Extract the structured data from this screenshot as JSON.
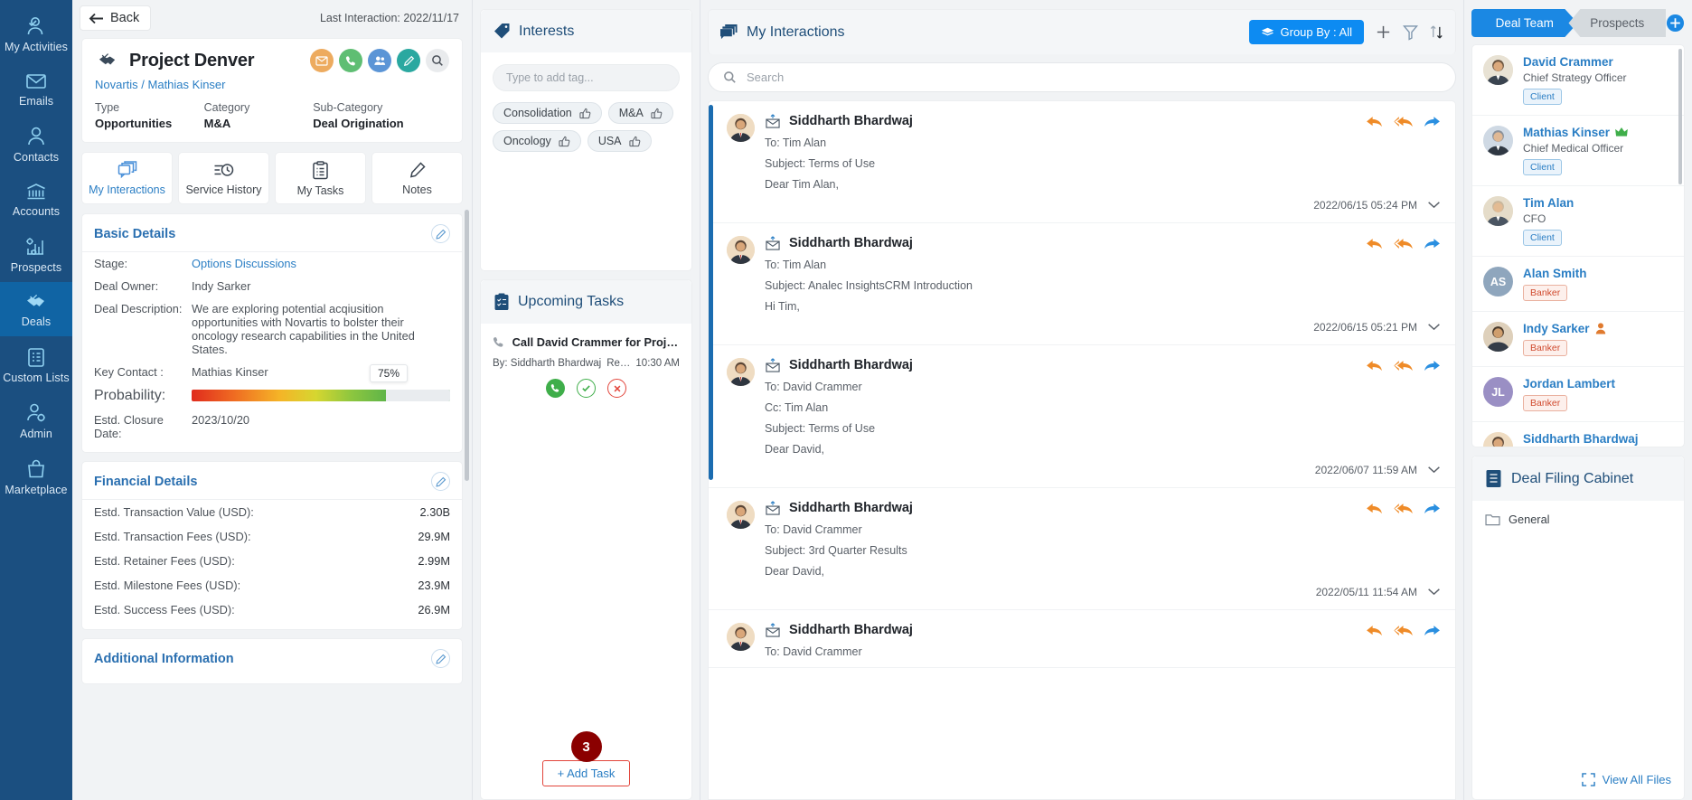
{
  "leftnav": {
    "items": [
      {
        "label": "My Activities",
        "icon": "user-check-icon",
        "active": false
      },
      {
        "label": "Emails",
        "icon": "envelope-icon",
        "active": false
      },
      {
        "label": "Contacts",
        "icon": "user-icon",
        "active": false
      },
      {
        "label": "Accounts",
        "icon": "bank-icon",
        "active": false
      },
      {
        "label": "Prospects",
        "icon": "chart-gear-icon",
        "active": false
      },
      {
        "label": "Deals",
        "icon": "handshake-check-icon",
        "active": true
      },
      {
        "label": "Custom Lists",
        "icon": "clipboard-list-icon",
        "active": false
      },
      {
        "label": "Admin",
        "icon": "user-gear-icon",
        "active": false
      },
      {
        "label": "Marketplace",
        "icon": "shopping-bag-icon",
        "active": false
      }
    ]
  },
  "detail": {
    "back_label": "Back",
    "last_interaction": "Last Interaction: 2022/11/17",
    "deal_title": "Project Denver",
    "deal_subtitle": "Novartis / Mathias Kinser",
    "actions": [
      {
        "name": "email-action",
        "icon": "envelope-icon"
      },
      {
        "name": "call-action",
        "icon": "phone-icon"
      },
      {
        "name": "meeting-action",
        "icon": "users-icon"
      },
      {
        "name": "note-action",
        "icon": "pencil-icon"
      },
      {
        "name": "search-action",
        "icon": "search-icon"
      }
    ],
    "meta": [
      {
        "key": "Type",
        "value": "Opportunities"
      },
      {
        "key": "Category",
        "value": "M&A"
      },
      {
        "key": "Sub-Category",
        "value": "Deal Origination"
      }
    ],
    "tabs": [
      {
        "label": "My Interactions",
        "icon": "chat-stack-icon",
        "active": true
      },
      {
        "label": "Service History",
        "icon": "history-icon",
        "active": false
      },
      {
        "label": "My Tasks",
        "icon": "clipboard-icon",
        "active": false
      },
      {
        "label": "Notes",
        "icon": "note-pencil-icon",
        "active": false
      }
    ],
    "basic": {
      "title": "Basic Details",
      "rows": [
        {
          "key": "Stage:",
          "value": "Options Discussions",
          "link": true
        },
        {
          "key": "Deal Owner:",
          "value": "Indy Sarker",
          "link": false
        },
        {
          "key": "Deal Description:",
          "value": "We are exploring potential acqiusition opportunities with Novartis to bolster their oncology research capabilities in the United States.",
          "link": false
        },
        {
          "key": "Key Contact :",
          "value": "Mathias Kinser",
          "link": false
        }
      ],
      "probability_label": "Probability:",
      "probability_value": "75%",
      "probability_pct": 75,
      "closure_key": "Estd. Closure Date:",
      "closure_value": "2023/10/20"
    },
    "financial": {
      "title": "Financial Details",
      "rows": [
        {
          "key": "Estd. Transaction Value (USD):",
          "value": "2.30B"
        },
        {
          "key": "Estd. Transaction Fees (USD):",
          "value": "29.9M"
        },
        {
          "key": "Estd. Retainer Fees (USD):",
          "value": "2.99M"
        },
        {
          "key": "Estd. Milestone Fees (USD):",
          "value": "23.9M"
        },
        {
          "key": "Estd. Success Fees (USD):",
          "value": "26.9M"
        }
      ]
    },
    "additional": {
      "title": "Additional Information"
    }
  },
  "interests": {
    "title": "Interests",
    "icon": "tag-icon",
    "input_placeholder": "Type to add tag...",
    "tags": [
      "Consolidation",
      "M&A",
      "Oncology",
      "USA"
    ]
  },
  "tasks": {
    "title": "Upcoming Tasks",
    "icon": "clipboard-check-icon",
    "item": {
      "title": "Call David Crammer for Project ...",
      "by": "By: Siddharth Bhardwaj",
      "recipient": "Recipien...",
      "time": "10:30 AM"
    },
    "badge": "3",
    "add_label": "+ Add Task"
  },
  "interactions": {
    "title": "My Interactions",
    "icon": "chat-stack-icon",
    "group_by_label": "Group By : All",
    "search_placeholder": "Search",
    "tools": [
      "add-icon",
      "filter-icon",
      "sort-icon"
    ],
    "items": [
      {
        "name": "Siddharth Bhardwaj",
        "to": "To: Tim Alan",
        "cc": "",
        "subject": "Subject: Terms of Use",
        "preview": "Dear Tim Alan,",
        "date": "2022/06/15 05:24 PM"
      },
      {
        "name": "Siddharth Bhardwaj",
        "to": "To: Tim Alan",
        "cc": "",
        "subject": "Subject: Analec InsightsCRM Introduction",
        "preview": "Hi Tim,",
        "date": "2022/06/15 05:21 PM"
      },
      {
        "name": "Siddharth Bhardwaj",
        "to": "To: David Crammer",
        "cc": "Cc: Tim Alan",
        "subject": "Subject: Terms of Use",
        "preview": "Dear David,",
        "date": "2022/06/07 11:59 AM"
      },
      {
        "name": "Siddharth Bhardwaj",
        "to": "To: David Crammer",
        "cc": "",
        "subject": "Subject: 3rd Quarter Results",
        "preview": "Dear David,",
        "date": "2022/05/11 11:54 AM"
      },
      {
        "name": "Siddharth Bhardwaj",
        "to": "To: David Crammer",
        "cc": "",
        "subject": "",
        "preview": "",
        "date": ""
      }
    ]
  },
  "team": {
    "tab_active": "Deal Team",
    "tab_inactive": "Prospects",
    "members": [
      {
        "name": "David Crammer",
        "role": "Chief Strategy Officer",
        "badge": "Client",
        "badge_type": "client",
        "initials": "",
        "avatar_color": "#f0dcc0",
        "photo": true,
        "crown": false,
        "person_icon": false
      },
      {
        "name": "Mathias Kinser",
        "role": "Chief Medical Officer",
        "badge": "Client",
        "badge_type": "client",
        "initials": "",
        "avatar_color": "#d8e3ee",
        "photo": true,
        "crown": true,
        "person_icon": false
      },
      {
        "name": "Tim Alan",
        "role": "CFO",
        "badge": "Client",
        "badge_type": "client",
        "initials": "",
        "avatar_color": "#e8dcc8",
        "photo": true,
        "crown": false,
        "person_icon": false
      },
      {
        "name": "Alan Smith",
        "role": "",
        "badge": "Banker",
        "badge_type": "banker",
        "initials": "AS",
        "avatar_color": "#8fa6bd",
        "photo": false,
        "crown": false,
        "person_icon": false
      },
      {
        "name": "Indy Sarker",
        "role": "",
        "badge": "Banker",
        "badge_type": "banker",
        "initials": "",
        "avatar_color": "#e0d0bc",
        "photo": true,
        "crown": false,
        "person_icon": true
      },
      {
        "name": "Jordan Lambert",
        "role": "",
        "badge": "Banker",
        "badge_type": "banker",
        "initials": "JL",
        "avatar_color": "#9a8fc4",
        "photo": false,
        "crown": false,
        "person_icon": false
      },
      {
        "name": "Siddharth Bhardwaj",
        "role": "",
        "badge": "",
        "badge_type": "",
        "initials": "",
        "avatar_color": "#f0dcc0",
        "photo": true,
        "crown": false,
        "person_icon": false
      }
    ]
  },
  "cabinet": {
    "title": "Deal Filing Cabinet",
    "icon": "cabinet-icon",
    "folder": "General",
    "view_all": "View All Files"
  }
}
